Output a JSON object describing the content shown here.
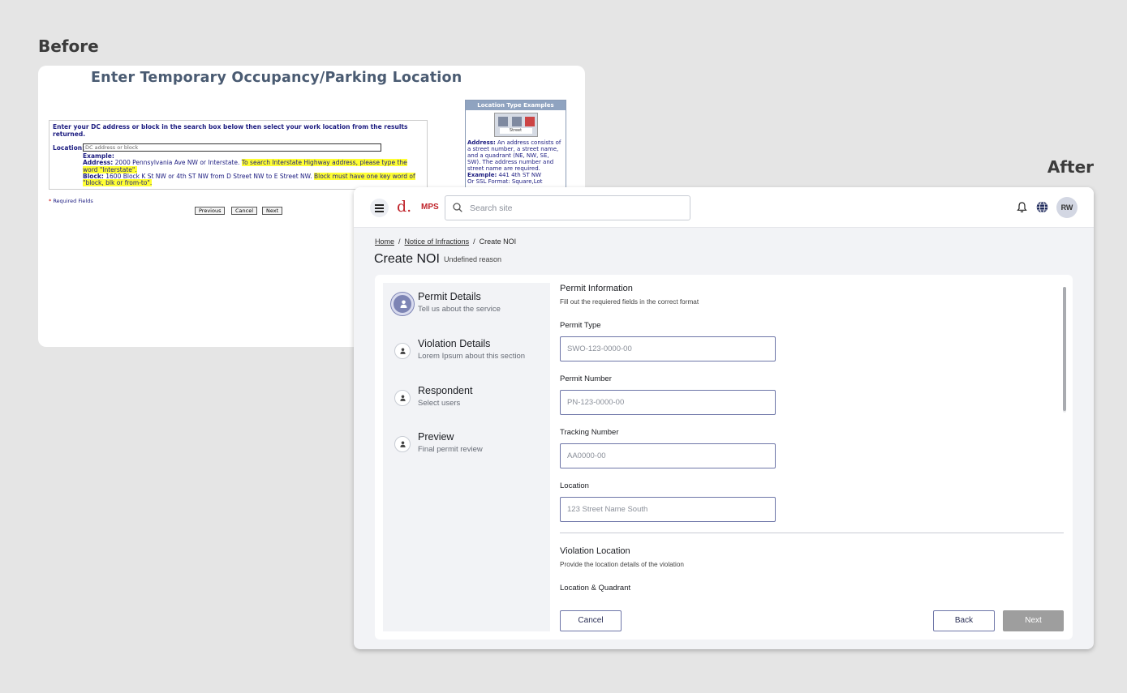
{
  "labels": {
    "before": "Before",
    "after": "After"
  },
  "before": {
    "title": "Enter Temporary Occupancy/Parking Location",
    "instruction": "Enter your DC address or block in the search box below then select your work location from the results returned.",
    "location_label": "Location:",
    "location_placeholder": "DC address or block",
    "example_label": "Example:",
    "address_label": "Address:",
    "address_example": "2000 Pennsylvania Ave NW or Interstate.",
    "address_hint": "To search Interstate Highway address, please type the word \"Interstate\".",
    "block_label": "Block:",
    "block_example": "1600 Block K St NW or 4th ST NW from D Street NW to E Street NW.",
    "block_hint": "Block must have one key word of \"block, blk or from-to\".",
    "required_star": "*",
    "required_text": "Required Fields",
    "buttons": {
      "previous": "Previous",
      "cancel": "Cancel",
      "next": "Next"
    },
    "side": {
      "header": "Location Type Examples",
      "image_caption": "Street",
      "address_label": "Address:",
      "address_text": "An address consists of a street number, a street name, and a quadrant (NE, NW, SE, SW). The address number and street name are required.",
      "example_label": "Example:",
      "example_text": "441 4th ST NW",
      "ssl_text": "Or SSL Format: Square,Lot"
    }
  },
  "after": {
    "brand": {
      "logo": "d.",
      "name": "MPS"
    },
    "search_placeholder": "Search site",
    "avatar": "RW",
    "breadcrumb": {
      "home": "Home",
      "notices": "Notice of  Infractions",
      "current": "Create NOI",
      "separator": "/"
    },
    "page_title": "Create NOI",
    "page_subtitle": "Undefined reason",
    "steps": [
      {
        "title": "Permit Details",
        "desc": "Tell us about the service"
      },
      {
        "title": "Violation Details",
        "desc": "Lorem Ipsum about this section"
      },
      {
        "title": "Respondent",
        "desc": "Select users"
      },
      {
        "title": "Preview",
        "desc": "Final permit review"
      }
    ],
    "permit_info": {
      "title": "Permit Information",
      "desc": "Fill out the requiered fields in the correct format"
    },
    "fields": [
      {
        "label": "Permit Type",
        "placeholder": "SWO-123-0000-00"
      },
      {
        "label": "Permit Number",
        "placeholder": "PN-123-0000-00"
      },
      {
        "label": "Tracking Number",
        "placeholder": "AA0000-00"
      },
      {
        "label": "Location",
        "placeholder": "123 Street Name South"
      }
    ],
    "violation_location": {
      "title": "Violation Location",
      "desc": "Provide the location details of the violation"
    },
    "location_quadrant_label": "Location & Quadrant",
    "buttons": {
      "cancel": "Cancel",
      "back": "Back",
      "next": "Next"
    }
  }
}
